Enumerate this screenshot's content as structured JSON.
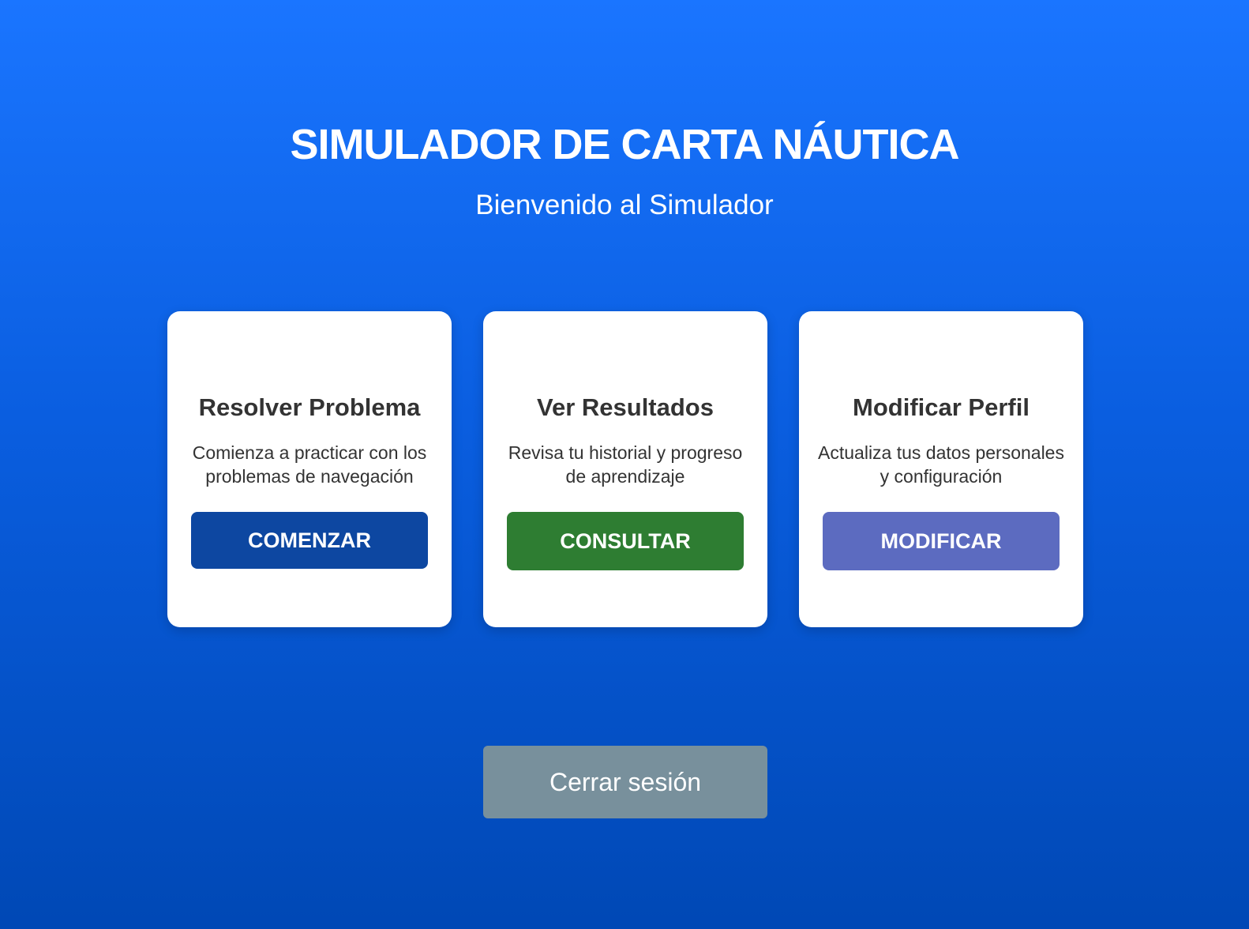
{
  "header": {
    "title": "SIMULADOR DE CARTA NÁUTICA",
    "subtitle": "Bienvenido al Simulador"
  },
  "cards": [
    {
      "title": "Resolver Problema",
      "description": "Comienza a practicar con los problemas de navegación",
      "button_label": "COMENZAR",
      "button_color": "#0d47a1"
    },
    {
      "title": "Ver Resultados",
      "description": "Revisa tu historial y progreso de aprendizaje",
      "button_label": "CONSULTAR",
      "button_color": "#2e7d32"
    },
    {
      "title": "Modificar Perfil",
      "description": "Actualiza tus datos personales y configuración",
      "button_label": "MODIFICAR",
      "button_color": "#5c6bc0"
    }
  ],
  "footer": {
    "logout_label": "Cerrar sesión"
  },
  "colors": {
    "background_top": "#1a75ff",
    "background_bottom": "#0048b5",
    "logout_button": "#78909c"
  }
}
